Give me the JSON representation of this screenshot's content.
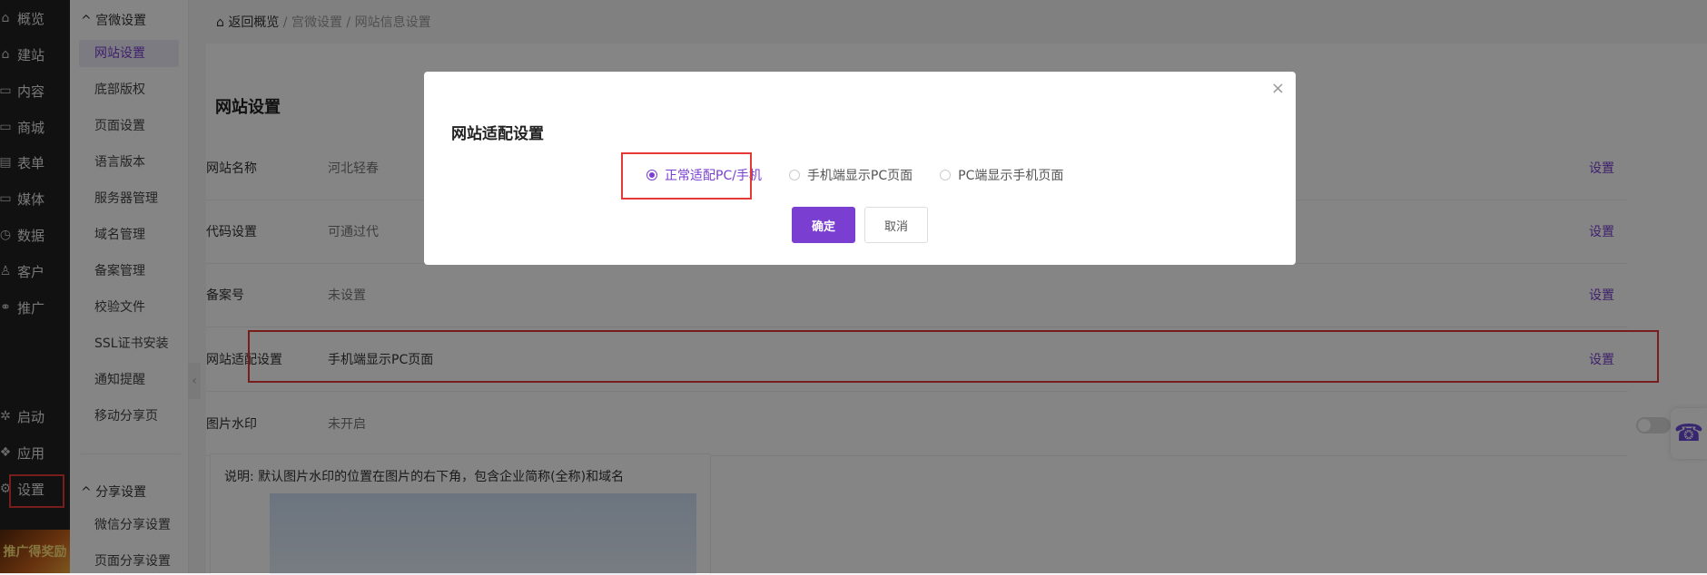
{
  "left_nav": [
    {
      "icon": "shop-icon",
      "glyph": "⌂",
      "label": "概览"
    },
    {
      "icon": "home-icon",
      "glyph": "⌂",
      "label": "建站"
    },
    {
      "icon": "content-icon",
      "glyph": "▭",
      "label": "内容"
    },
    {
      "icon": "store-icon",
      "glyph": "▭",
      "label": "商城"
    },
    {
      "icon": "form-icon",
      "glyph": "▤",
      "label": "表单"
    },
    {
      "icon": "media-icon",
      "glyph": "▭",
      "label": "媒体"
    },
    {
      "icon": "data-icon",
      "glyph": "◷",
      "label": "数据"
    },
    {
      "icon": "customer-icon",
      "glyph": "♙",
      "label": "客户"
    },
    {
      "icon": "promote-icon",
      "glyph": "⚭",
      "label": "推广"
    },
    {
      "icon": "launch-icon",
      "glyph": "✲",
      "label": "启动"
    },
    {
      "icon": "apps-icon",
      "glyph": "❖",
      "label": "应用"
    },
    {
      "icon": "settings-icon",
      "glyph": "⚙",
      "label": "设置"
    }
  ],
  "promo_label": "推广得奖励",
  "sub_nav": {
    "group1": "宫微设置",
    "items1": [
      "网站设置",
      "底部版权",
      "页面设置",
      "语言版本",
      "服务器管理",
      "域名管理",
      "备案管理",
      "校验文件",
      "SSL证书安装",
      "通知提醒",
      "移动分享页"
    ],
    "group2": "分享设置",
    "items2": [
      "微信分享设置",
      "页面分享设置"
    ]
  },
  "breadcrumb": {
    "home": "返回概览",
    "sep": "/",
    "level1": "宫微设置",
    "level2": "网站信息设置"
  },
  "page": {
    "title": "网站设置",
    "rows": [
      {
        "label": "网站名称",
        "value": "河北轻春",
        "action": "设置"
      },
      {
        "label": "代码设置",
        "value": "可通过代",
        "action": "设置"
      },
      {
        "label": "备案号",
        "value": "未设置",
        "action": "设置"
      },
      {
        "label": "网站适配设置",
        "value": "手机端显示PC页面",
        "action": "设置"
      },
      {
        "label": "图片水印",
        "value": "未开启",
        "action": ""
      }
    ],
    "watermark_desc": "说明:   默认图片水印的位置在图片的右下角，包含企业简称(全称)和域名"
  },
  "dialog": {
    "title": "网站适配设置",
    "options": [
      "正常适配PC/手机",
      "手机端显示PC页面",
      "PC端显示手机页面"
    ],
    "selected": "正常适配PC/手机",
    "ok": "确定",
    "cancel": "取消",
    "close": "×"
  }
}
